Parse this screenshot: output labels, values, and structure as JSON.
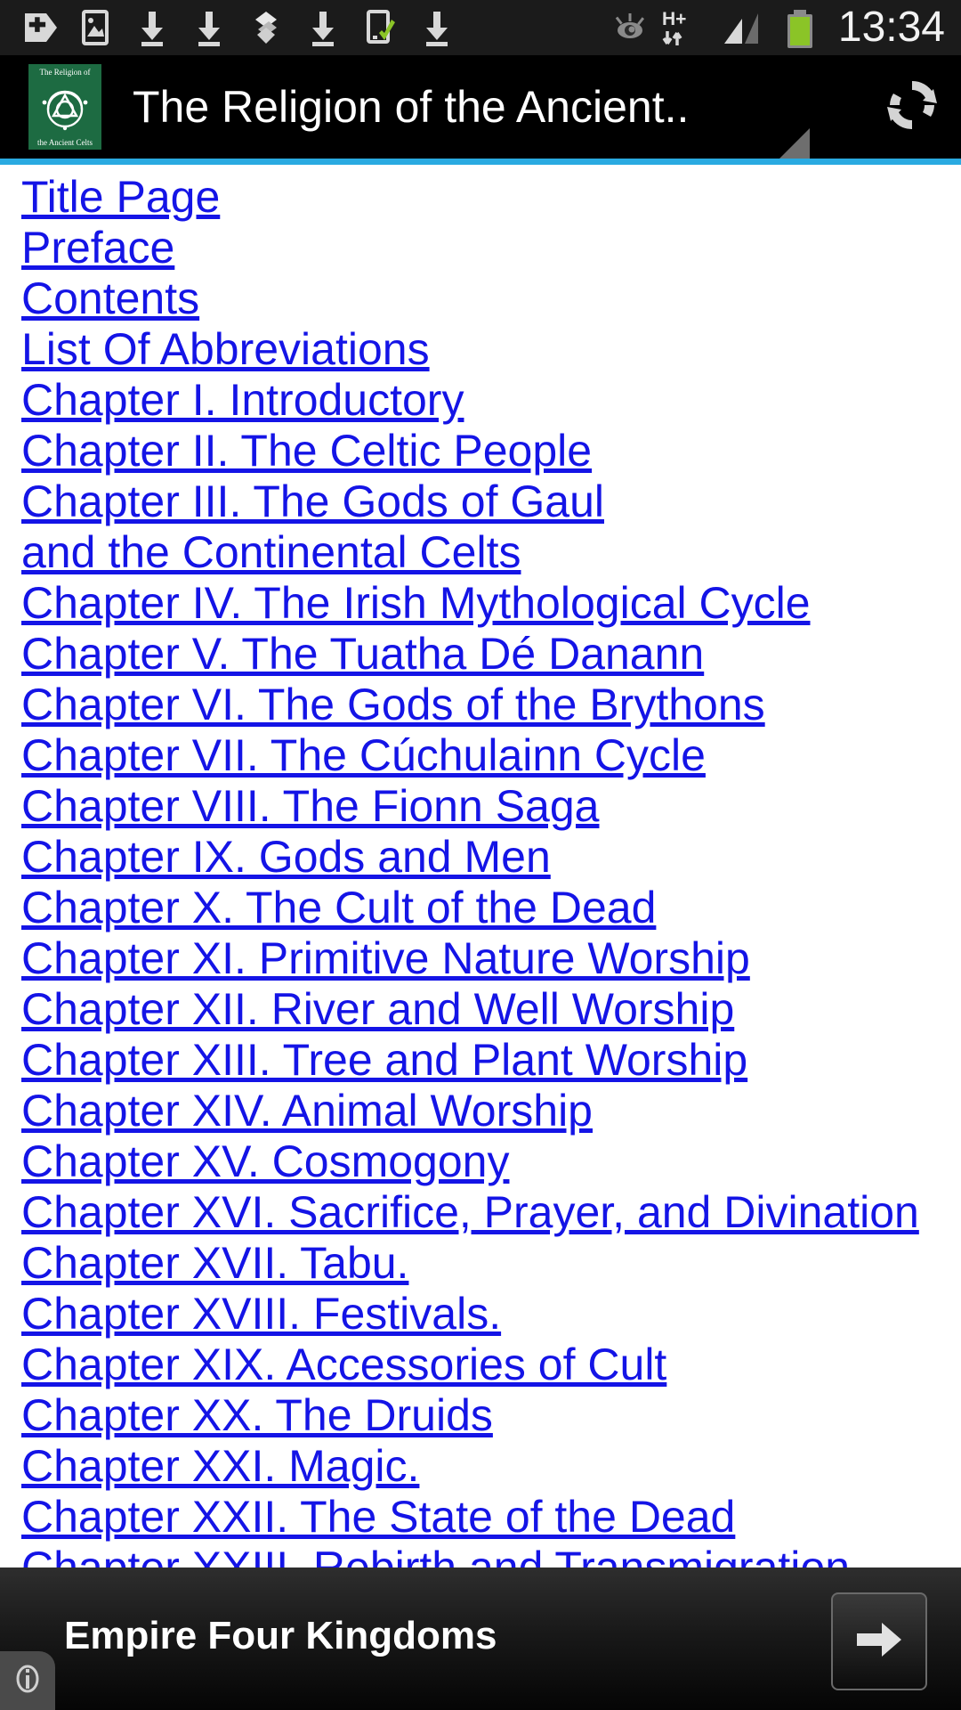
{
  "status_bar": {
    "time": "13:34",
    "left_icons": [
      "medical-plus-icon",
      "gallery-image-icon",
      "download-icon",
      "download-icon",
      "dropbox-icon",
      "download-icon",
      "phone-check-icon",
      "download-icon"
    ],
    "right_icons": [
      "eye-icon",
      "hplus-data-icon",
      "signal-bars-icon",
      "battery-icon"
    ],
    "network_label": "H+",
    "colors": {
      "background": "#1b1b1b",
      "icon": "#d8d8d8",
      "battery": "#8bc427"
    }
  },
  "app_bar": {
    "title": "The Religion of the Ancient..",
    "cover": {
      "top_text": "The Religion of",
      "bottom_text": "the Ancient Celts",
      "background": "#1d6b42",
      "art": "celtic-knot"
    },
    "refresh_icon": "refresh-icon",
    "resize_handle": "corner-resize-triangle",
    "colors": {
      "background": "#000000",
      "title": "#ffffff",
      "accent_line": "#2aaae1"
    }
  },
  "content": {
    "link_color": "#1414e6",
    "background": "#ffffff",
    "links": [
      "Title Page",
      "Preface",
      "Contents",
      "List Of Abbreviations",
      "Chapter I. Introductory",
      "Chapter II. The Celtic People",
      "Chapter III. The Gods of Gaul and the Continental Celts",
      "Chapter IV. The Irish Mythological Cycle",
      "Chapter V. The Tuatha Dé Danann",
      "Chapter VI. The Gods of the Brythons",
      "Chapter VII. The Cúchulainn Cycle",
      "Chapter VIII. The Fionn Saga",
      "Chapter IX. Gods and Men",
      "Chapter X. The Cult of the Dead",
      "Chapter XI. Primitive Nature Worship",
      "Chapter XII. River and Well Worship",
      "Chapter XIII. Tree and Plant Worship",
      "Chapter XIV. Animal Worship",
      "Chapter XV. Cosmogony",
      "Chapter XVI. Sacrifice, Prayer, and Divination",
      "Chapter XVII. Tabu.",
      "Chapter XVIII. Festivals.",
      "Chapter XIX. Accessories of Cult",
      "Chapter XX. The Druids",
      "Chapter XXI. Magic.",
      "Chapter XXII. The State of the Dead",
      "Chapter XXIII. Rebirth and Transmigration"
    ]
  },
  "ad_banner": {
    "title": "Empire Four Kingdoms",
    "cta_icon": "arrow-right-icon",
    "info_icon": "info-icon",
    "background": "#121212"
  }
}
